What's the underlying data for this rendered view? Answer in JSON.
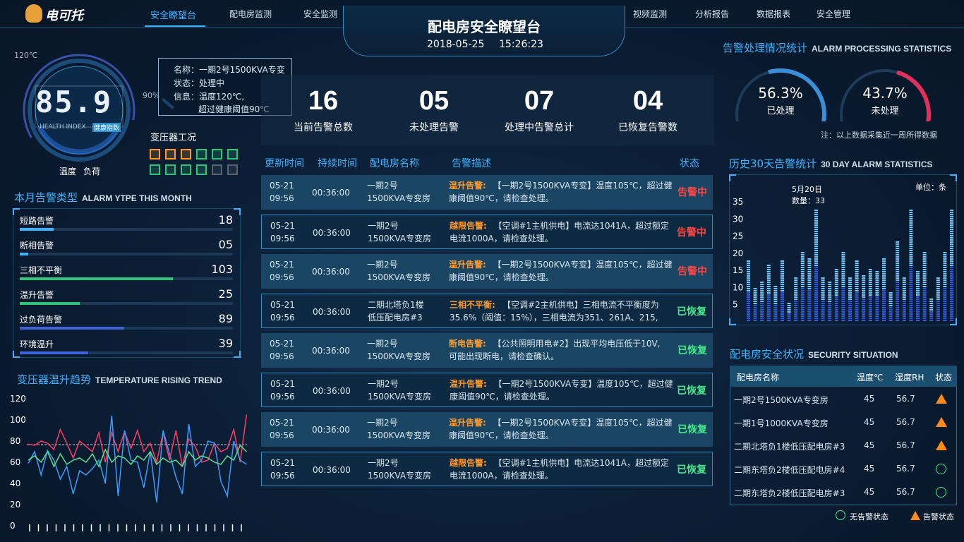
{
  "brand": {
    "name": "电可托"
  },
  "nav_left": [
    "安全瞭望台",
    "配电房监测",
    "安全监测"
  ],
  "nav_right": [
    "视频监测",
    "分析报告",
    "数据报表",
    "安全管理"
  ],
  "header": {
    "title": "配电房安全瞭望台",
    "date": "2018-05-25",
    "time": "15:26:23"
  },
  "gauge": {
    "value": "85.9",
    "top_label": "120℃",
    "side_label": "90%",
    "sub_en": "HEALTH INDEX",
    "sub_cn": "健康指数",
    "bottom_left": "温度",
    "bottom_right": "负荷"
  },
  "info_box": {
    "name": "名称：一期2号1500KVA专变",
    "status": "状态：处理中",
    "info": "信息：温度120℃,",
    "info2": "超过健康阈值90℃"
  },
  "transformer": {
    "title": "变压器工况"
  },
  "alarm_types": {
    "title": "本月告警类型",
    "en": "ALARM YTPE THIS MONTH",
    "items": [
      {
        "label": "短路告警",
        "value": "18",
        "ratio": 0.16,
        "color": "#3ab3ff"
      },
      {
        "label": "断相告警",
        "value": "05",
        "ratio": 0.04,
        "color": "#3ab3ff"
      },
      {
        "label": "三相不平衡",
        "value": "103",
        "ratio": 0.72,
        "color": "#31c37a"
      },
      {
        "label": "温升告警",
        "value": "25",
        "ratio": 0.28,
        "color": "#31c37a"
      },
      {
        "label": "过负荷告警",
        "value": "89",
        "ratio": 0.49,
        "color": "#3f63d8"
      },
      {
        "label": "环境温升",
        "value": "39",
        "ratio": 0.32,
        "color": "#3f63d8"
      }
    ]
  },
  "trend": {
    "title": "变压器温升趋势",
    "en": "TEMPERATURE RISING TREND",
    "y_ticks": [
      "120",
      "100",
      "80",
      "60",
      "40",
      "20",
      "0"
    ]
  },
  "stats": [
    {
      "value": "16",
      "label": "当前告警总数"
    },
    {
      "value": "05",
      "label": "未处理告警"
    },
    {
      "value": "07",
      "label": "处理中告警总计"
    },
    {
      "value": "04",
      "label": "已恢复告警数"
    }
  ],
  "table": {
    "headers": [
      "更新时间",
      "持续时间",
      "配电房名称",
      "告警描述",
      "状态"
    ],
    "rows": [
      {
        "date": "05-21",
        "time": "09:56",
        "dur": "00:36:00",
        "room1": "一期2号",
        "room2": "1500KVA专变房",
        "tag": "温升告警:",
        "desc1": "【一期2号1500KVA专变】温度105℃，超过健",
        "desc2": "康阈值90℃，请检查处理。",
        "status": "告警中",
        "kind": "red"
      },
      {
        "date": "05-21",
        "time": "09:56",
        "dur": "00:36:00",
        "room1": "一期2号",
        "room2": "1500KVA专变房",
        "tag": "越限告警:",
        "desc1": "【空调#1主机供电】电流达1041A，超过额定",
        "desc2": "电流1000A，请检查处理。",
        "status": "告警中",
        "kind": "red"
      },
      {
        "date": "05-21",
        "time": "09:56",
        "dur": "00:36:00",
        "room1": "一期2号",
        "room2": "1500KVA专变房",
        "tag": "温升告警:",
        "desc1": "【一期2号1500KVA专变】温度105℃，超过健",
        "desc2": "康阈值90℃，请检查处理。",
        "status": "告警中",
        "kind": "red"
      },
      {
        "date": "05-21",
        "time": "09:56",
        "dur": "00:36:00",
        "room1": "二期北塔负1楼",
        "room2": "低压配电房#3",
        "tag": "三相不平衡:",
        "desc1": "【空调#2主机供电】三相电流不平衡度为",
        "desc2": "35.6%（阈值：15%），三相电流为351、261A、215,",
        "status": "已恢复",
        "kind": "green"
      },
      {
        "date": "05-21",
        "time": "09:56",
        "dur": "00:36:00",
        "room1": "一期2号",
        "room2": "1500KVA专变房",
        "tag": "断电告警:",
        "desc1": "【公共照明用电#2】出现平均电压低于10V,",
        "desc2": "可能出现断电，请检查确认。",
        "status": "已恢复",
        "kind": "green"
      },
      {
        "date": "05-21",
        "time": "09:56",
        "dur": "00:36:00",
        "room1": "一期2号",
        "room2": "1500KVA专变房",
        "tag": "温升告警:",
        "desc1": "【一期2号1500KVA专变】温度105℃，超过健",
        "desc2": "康阈值90℃，请检查处理。",
        "status": "已恢复",
        "kind": "green"
      },
      {
        "date": "05-21",
        "time": "09:56",
        "dur": "00:36:00",
        "room1": "一期2号",
        "room2": "1500KVA专变房",
        "tag": "温升告警:",
        "desc1": "【一期2号1500KVA专变】温度105℃，超过健",
        "desc2": "康阈值90℃，请检查处理。",
        "status": "已恢复",
        "kind": "green"
      },
      {
        "date": "05-21",
        "time": "09:56",
        "dur": "00:36:00",
        "room1": "一期2号",
        "room2": "1500KVA专变房",
        "tag": "越限告警:",
        "desc1": "【空调#1主机供电】电流达1041A，超过额定",
        "desc2": "电流1000A，请检查处理。",
        "status": "已恢复",
        "kind": "green"
      }
    ]
  },
  "processing": {
    "title": "告警处理情况统计",
    "en": "ALARM PROCESSING STATISTICS",
    "done_pct": "56.3%",
    "done_label": "已处理",
    "done_ratio": 0.563,
    "undone_pct": "43.7%",
    "undone_label": "未处理",
    "undone_ratio": 0.437,
    "note": "注：以上数据采集近一周所得数据"
  },
  "history": {
    "title": "历史30天告警统计",
    "en": "30 DAY ALARM STATISTICS",
    "unit": "单位：条",
    "tip_date": "5月20日",
    "tip_count": "数量：33",
    "y_ticks": [
      "35",
      "30",
      "25",
      "20",
      "15",
      "10",
      "5"
    ]
  },
  "chart_data": {
    "type": "bar",
    "title": "历史30天告警统计",
    "values": [
      18,
      10,
      12,
      17,
      11,
      18,
      6,
      13,
      21,
      19,
      33,
      13,
      12,
      16,
      21,
      13,
      18,
      14,
      16,
      15,
      19,
      9,
      24,
      13,
      33,
      15,
      21,
      7,
      13,
      21,
      33,
      11
    ],
    "ylim": [
      0,
      35
    ]
  },
  "security": {
    "title": "配电房安全状况",
    "en": "SECURITY SITUATION",
    "headers": [
      "配电房名称",
      "温度℃",
      "湿度RH",
      "状态"
    ],
    "rows": [
      {
        "name": "一期2号1500KVA专变房",
        "temp": "45",
        "rh": "56.7",
        "state": "warn"
      },
      {
        "name": "一期1号1000KVA专变房",
        "temp": "45",
        "rh": "56.7",
        "state": "warn"
      },
      {
        "name": "二期北塔负1楼低压配电房#3",
        "temp": "45",
        "rh": "56.7",
        "state": "warn"
      },
      {
        "name": "二期东塔负2楼低压配电房#4",
        "temp": "45",
        "rh": "56.7",
        "state": "ok"
      },
      {
        "name": "二期东塔负2楼低压配电房#3",
        "temp": "45",
        "rh": "56.7",
        "state": "ok"
      }
    ],
    "legend_ok": "无告警状态",
    "legend_warn": "告警状态"
  },
  "colors": {
    "accent": "#3ab3ff",
    "alarm": "#ff4444",
    "ok": "#45e88a",
    "warn": "#ff9a2a"
  }
}
